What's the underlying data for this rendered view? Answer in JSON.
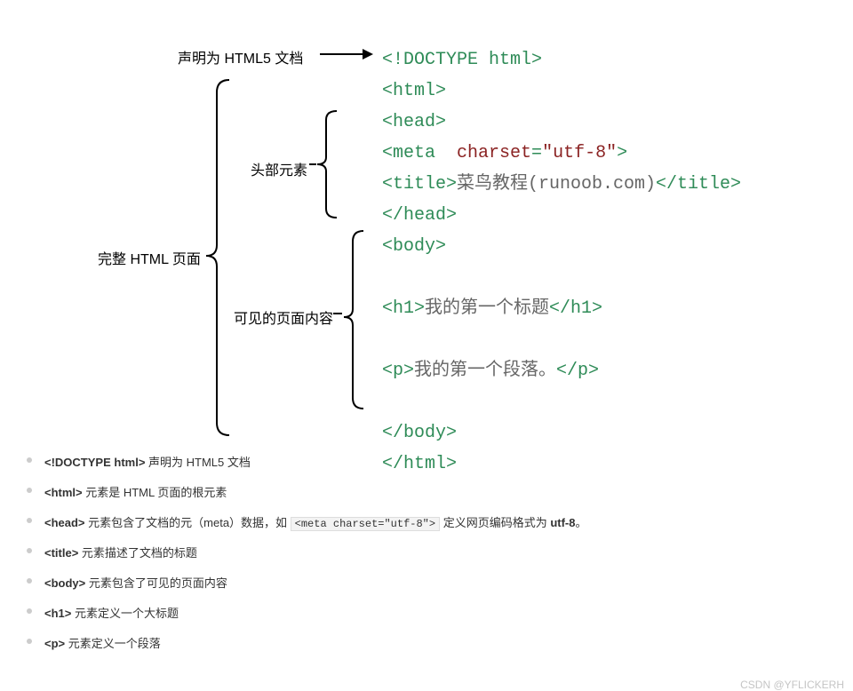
{
  "labels": {
    "doctype": "声明为 HTML5 文档",
    "page": "完整 HTML 页面",
    "head": "头部元素",
    "body": "可见的页面内容"
  },
  "code": {
    "l1_a": "<!",
    "l1_b": "DOCTYPE html",
    "l1_c": ">",
    "l2": "<html>",
    "l3": "<head>",
    "l4_a": "<meta",
    "l4_sp": "  ",
    "l4_b": "charset",
    "l4_c": "=",
    "l4_d": "\"utf-8\"",
    "l4_e": ">",
    "l5_a": "<title>",
    "l5_b": "菜鸟教程(runoob.com)",
    "l5_c": "</title>",
    "l6": "</head>",
    "l7": "<body>",
    "l8_a": "<h1>",
    "l8_b": "我的第一个标题",
    "l8_c": "</h1>",
    "l9_a": "<p>",
    "l9_b": "我的第一个段落。",
    "l9_c": "</p>",
    "l10": "</body>",
    "l11": "</html>"
  },
  "bullets": {
    "b1_tag": "<!DOCTYPE html>",
    "b1_text": " 声明为 HTML5 文档",
    "b2_tag": "<html>",
    "b2_text": " 元素是 HTML 页面的根元素",
    "b3_tag": "<head>",
    "b3_text_a": " 元素包含了文档的元（meta）数据，如 ",
    "b3_chip": "<meta charset=\"utf-8\">",
    "b3_text_b": " 定义网页编码格式为 ",
    "b3_utf": "utf-8",
    "b3_end": "。",
    "b4_tag": "<title>",
    "b4_text": " 元素描述了文档的标题",
    "b5_tag": "<body>",
    "b5_text": " 元素包含了可见的页面内容",
    "b6_tag": "<h1>",
    "b6_text": " 元素定义一个大标题",
    "b7_tag": "<p>",
    "b7_text": " 元素定义一个段落"
  },
  "watermark": "CSDN @YFLICKERH"
}
